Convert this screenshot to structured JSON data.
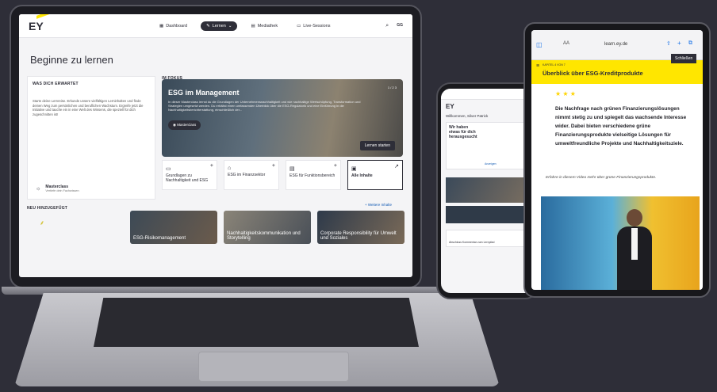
{
  "laptop": {
    "nav": {
      "logo": "EY",
      "items": [
        "Dashboard",
        "Lernen",
        "Mediathek",
        "Live-Sessions"
      ],
      "active": "Lernen",
      "user_initials": "GG"
    },
    "page_title": "Beginne zu lernen",
    "expect": {
      "label": "WAS DICH ERWARTET",
      "text": "Starte deine Lernreise. Erkunde unsere vielfältigen Lerninhalten und finde deinen Weg zum persönlichen und beruflichen Wachstum. Ergreife jetzt die Initiative und tauche ein in eine Welt des Wissens, die speziell für dich zugeschnitten ist!",
      "masterclass_title": "Masterclass",
      "masterclass_sub": "Vertiefe dein Fachwissen"
    },
    "focus": {
      "label": "IM FOKUS",
      "hero_title": "ESG im Management",
      "hero_text": "In dieser Masterclass lernst du die Grundlagen der Unternehmensnachhaltigkeit und wie nachhaltige Wertschöpfung, Transformation und Strategien umgesetzt werden. Du erhältst einen umfassenden Überblick über die ESG-Regulatorik und eine Einführung in die Nachhaltigkeitsberichterstattung, einschließlich der...",
      "pager": "1 / 2 3",
      "badge": "Masterclass",
      "cta": "Lernen starten"
    },
    "tiles": [
      {
        "icon": "▭",
        "label": "Grundlagen zu Nachhaltigkeit und ESG"
      },
      {
        "icon": "⌂",
        "label": "ESG im Finanzsektor"
      },
      {
        "icon": "▤",
        "label": "ESG für Funktionsbereich"
      },
      {
        "icon": "▣",
        "label": "Alle Inhalte"
      }
    ],
    "new": {
      "label": "NEU HINZUGEFÜGT",
      "more": "+ Weitere Inhalte",
      "items": [
        "ESG-Risikomanagement",
        "Nachhaltigkeitskommunikation und Storytelling",
        "Corporate Responsibility für Umwelt und Soziales"
      ]
    }
  },
  "phone": {
    "logo": "EY",
    "welcome": "Willkommen, Silver Patrick",
    "card_title": "Wir haben etwas für dich herausgesucht",
    "card_action": "Anzeigen",
    "footer": "Abschluss Kommentar zum Lernpfad"
  },
  "tablet": {
    "url": "learn.ey.de",
    "button": "Schließen",
    "chapter": "KAPITEL 4 VON 7",
    "title": "Überblick über ESG-Kreditprodukte",
    "stars": "★ ★ ★",
    "body": "Die Nachfrage nach grünen Finanzierungslösungen nimmt stetig zu und spiegelt das wachsende Interesse wider. Dabei bieten verschiedene grüne Finanzierungsprodukte vielseitige Lösungen für umweltfreundliche Projekte und Nachhaltigkeitsziele.",
    "caption": "Erfahre in diesem Video mehr über grüne Finanzierungsprodukte."
  },
  "colors": {
    "ey_yellow": "#ffe600",
    "ey_dark": "#2e2e38",
    "background": "#2e2e38"
  }
}
